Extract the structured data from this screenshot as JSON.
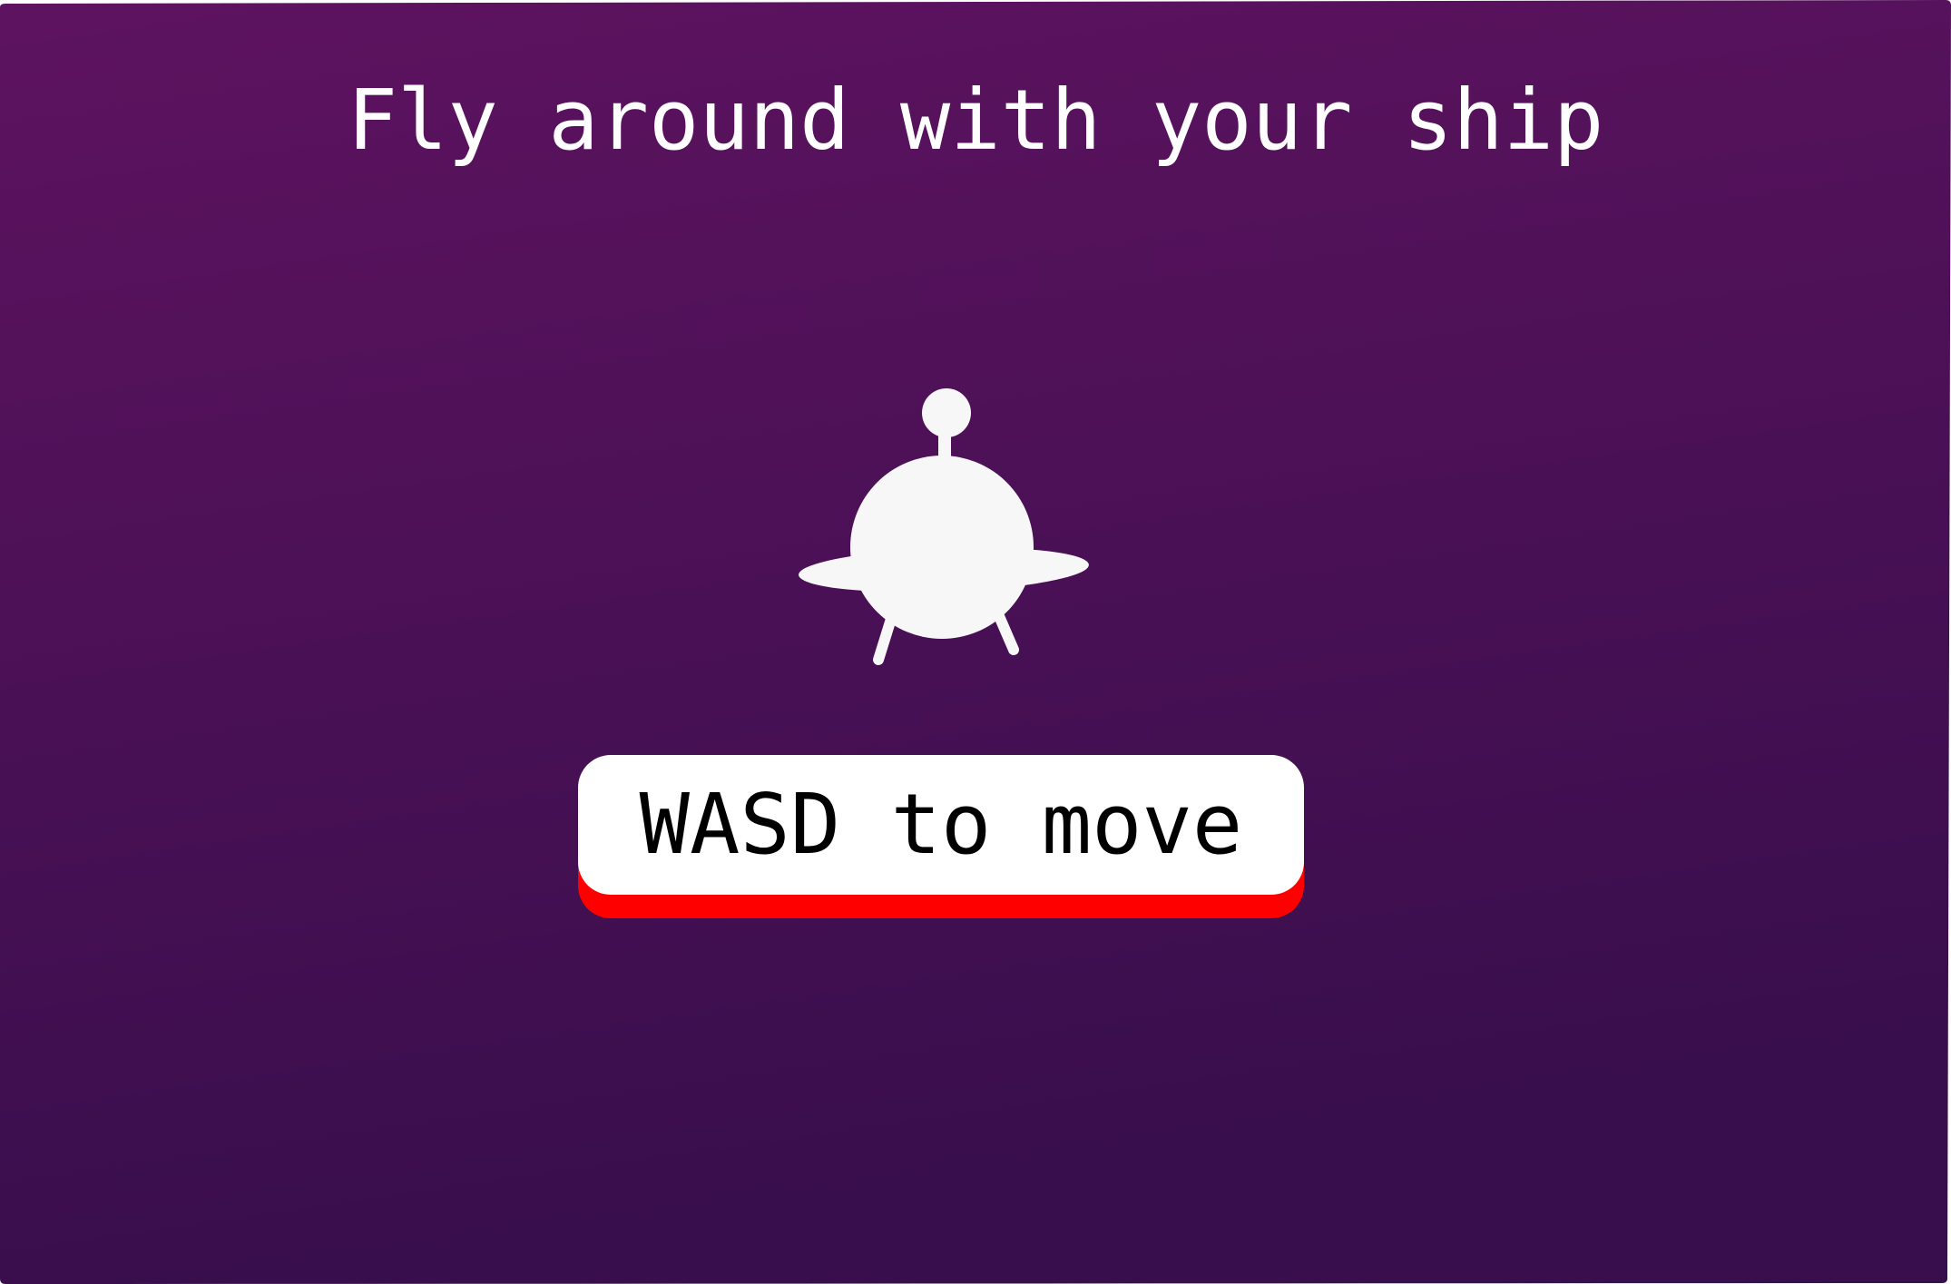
{
  "title": "Fly around with your ship",
  "hint": {
    "label": "WASD to move",
    "box_color": "#ffffff",
    "shadow_color": "#ff0000"
  },
  "ship": {
    "icon": "ufo-icon",
    "color": "#f7f7f7"
  },
  "colors": {
    "background_top": "#5e1360",
    "background_bottom": "#380e4c",
    "text": "#ffffff"
  }
}
